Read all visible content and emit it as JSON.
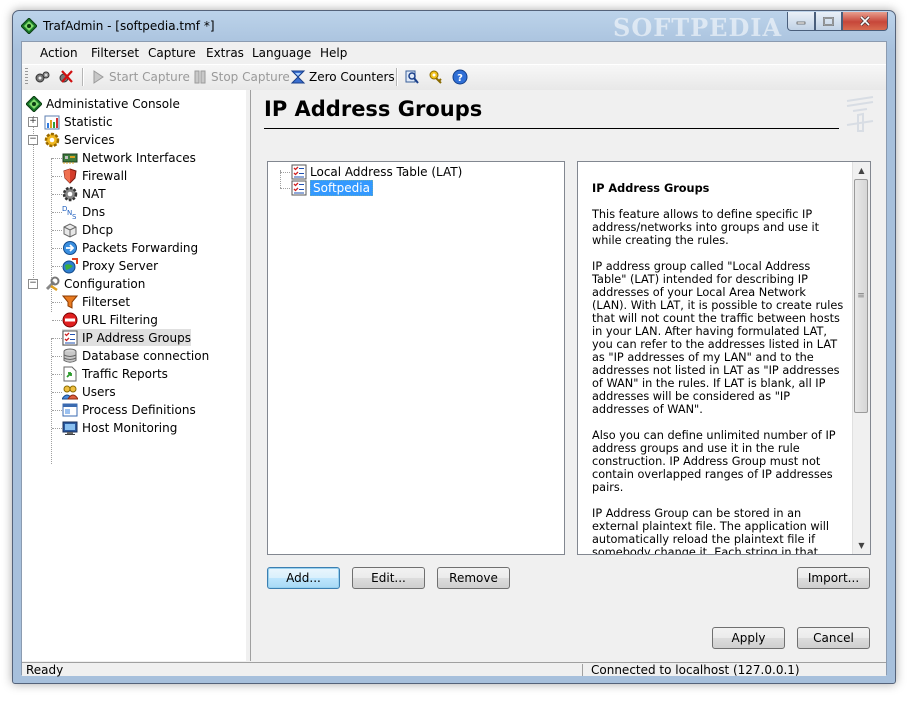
{
  "window": {
    "title": "TrafAdmin - [softpedia.tmf *]",
    "watermark": "SOFTPEDIA"
  },
  "menu": [
    "Action",
    "Filterset",
    "Capture",
    "Extras",
    "Language",
    "Help"
  ],
  "toolbar": {
    "start_capture": "Start Capture",
    "stop_capture": "Stop Capture",
    "zero_counters": "Zero Counters"
  },
  "tree": {
    "root": "Administative Console",
    "statistic": "Statistic",
    "services": "Services",
    "services_items": [
      "Network Interfaces",
      "Firewall",
      "NAT",
      "Dns",
      "Dhcp",
      "Packets Forwarding",
      "Proxy Server"
    ],
    "configuration": "Configuration",
    "configuration_items": [
      "Filterset",
      "URL Filtering",
      "IP Address Groups",
      "Database connection",
      "Traffic Reports",
      "Users",
      "Process Definitions",
      "Host Monitoring"
    ]
  },
  "page": {
    "title": "IP Address Groups"
  },
  "groups": [
    "Local Address Table (LAT)",
    "Softpedia"
  ],
  "description": {
    "heading": "IP Address Groups",
    "paragraphs": [
      "This feature allows to define specific IP address/networks into groups and use it while creating the rules.",
      "IP address group called \"Local Address Table\" (LAT) intended for describing IP addresses of your Local Area Network (LAN). With LAT, it is possible to create rules that will not count the traffic between hosts in your LAN. After having formulated LAT, you can refer to the addresses listed in LAT as \"IP addresses of my LAN\" and to the addresses not listed in LAT as \"IP addresses of WAN\" in the rules. If LAT is blank, all IP addresses will be considered as \"IP addresses of WAN\".",
      "Also you can define unlimited number of IP address groups and use it in the rule construction. IP Address Group must not contain overlapped ranges of IP addresses pairs.",
      "IP Address Group can be stored in an external plaintext file. The application will automatically reload the plaintext file if somebody change it. Each string in that"
    ]
  },
  "buttons": {
    "add": "Add...",
    "edit": "Edit...",
    "remove": "Remove",
    "import": "Import...",
    "apply": "Apply",
    "cancel": "Cancel"
  },
  "status": {
    "left": "Ready",
    "right": "Connected to localhost (127.0.0.1)"
  }
}
